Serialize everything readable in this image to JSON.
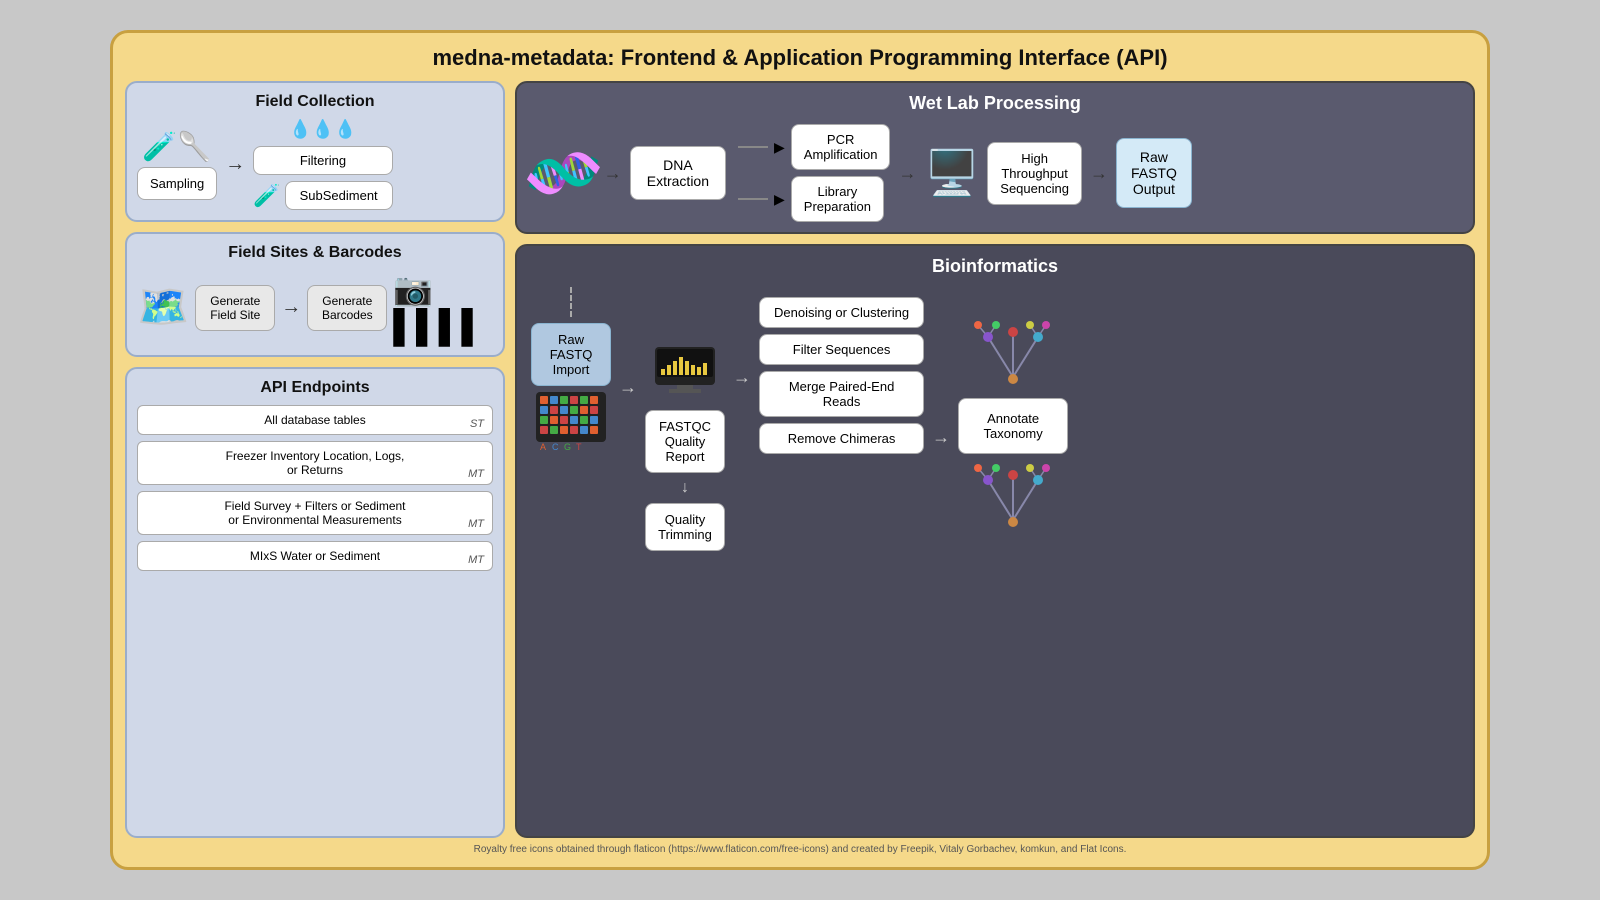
{
  "title": "medna-metadata: Frontend & Application Programming Interface (API)",
  "leftCol": {
    "fieldCollection": {
      "sectionTitle": "Field Collection",
      "sampling": "Sampling",
      "filtering": "Filtering",
      "subSediment": "SubSediment"
    },
    "fieldSites": {
      "sectionTitle": "Field Sites & Barcodes",
      "generateFieldSite": "Generate\nField Site",
      "generateBarcodes": "Generate\nBarcodes"
    },
    "apiEndpoints": {
      "sectionTitle": "API Endpoints",
      "items": [
        {
          "label": "All database tables",
          "badge": "ST"
        },
        {
          "label": "Freezer Inventory Location, Logs,\nor Returns",
          "badge": "MT"
        },
        {
          "label": "Field Survey + Filters or Sediment\nor Environmental Measurements",
          "badge": "MT"
        },
        {
          "label": "MIxS Water or Sediment",
          "badge": "MT"
        }
      ]
    }
  },
  "wetLab": {
    "sectionTitle": "Wet Lab Processing",
    "dnaExtraction": "DNA\nExtraction",
    "pcrAmplification": "PCR\nAmplification",
    "libraryPreparation": "Library\nPreparation",
    "highThroughputSequencing": "High\nThroughput\nSequencing",
    "rawFastqOutput": "Raw\nFASTQ\nOutput"
  },
  "bioinformatics": {
    "sectionTitle": "Bioinformatics",
    "rawFastqImport": "Raw\nFASTQ\nImport",
    "fastqcQualityReport": "FASTQC\nQuality\nReport",
    "qualityTrimming": "Quality\nTrimming",
    "denoisingOrClustering": "Denoising or\nClustering",
    "filterSequences": "Filter Sequences",
    "mergePairedEndReads": "Merge Paired-End\nReads",
    "removeChimeras": "Remove Chimeras",
    "annotateTaxonomy": "Annotate\nTaxonomy"
  },
  "footer": "Royalty free icons obtained through flaticon (https://www.flaticon.com/free-icons) and created by Freepik, Vitaly Gorbachev, komkun, and Flat Icons."
}
